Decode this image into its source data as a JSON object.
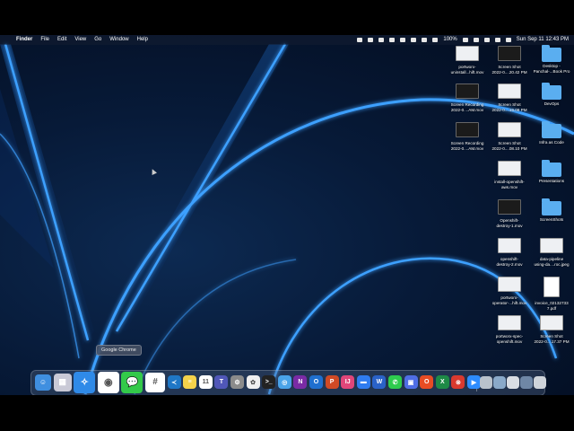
{
  "menubar": {
    "app_name": "Finder",
    "items": [
      "File",
      "Edit",
      "View",
      "Go",
      "Window",
      "Help"
    ],
    "battery": "100%",
    "datetime": "Sun Sep 11  12:43 PM"
  },
  "tooltip": "Google Chrome",
  "desktop_items": [
    {
      "label1": "portworx-",
      "label2": "uninstall...hift.mov",
      "kind": "light"
    },
    {
      "label1": "Screen Shot",
      "label2": "2022-0....20.42 PM",
      "kind": "dark"
    },
    {
      "label1": "Desktop -",
      "label2": "Panchal-...Book Pro",
      "kind": "folder"
    },
    {
      "label1": "Screen Recording",
      "label2": "2022-0....AM.mov",
      "kind": "dark"
    },
    {
      "label1": "Screen Shot",
      "label2": "2022-0....19.09 PM",
      "kind": "light"
    },
    {
      "label1": "DevOps",
      "label2": "",
      "kind": "folder"
    },
    {
      "label1": "Screen Recording",
      "label2": "2022-0....AM.mov",
      "kind": "dark"
    },
    {
      "label1": "Screen Shot",
      "label2": "2022-0....08.10 PM",
      "kind": "light"
    },
    {
      "label1": "Infra as Code",
      "label2": "",
      "kind": "folder"
    },
    {
      "label1": "install-openshift-",
      "label2": "aws.mov",
      "kind": "light"
    },
    {
      "label1": "Presentations",
      "label2": "",
      "kind": "folder"
    },
    {
      "label1": "Openshift-",
      "label2": "destroy-1.mov",
      "kind": "dark"
    },
    {
      "label1": "ScreenShots",
      "label2": "",
      "kind": "folder"
    },
    {
      "label1": "openshift-",
      "label2": "destroy-2.mov",
      "kind": "light"
    },
    {
      "label1": "data-pipeline",
      "label2": "using-da....roc.jpeg",
      "kind": "light"
    },
    {
      "label1": "portworx-",
      "label2": "operator-...hift.mov",
      "kind": "light"
    },
    {
      "label1": "invoice_02132733",
      "label2": "7.pdf",
      "kind": "doc"
    },
    {
      "label1": "portworx-spec-",
      "label2": "openshift.mov",
      "kind": "light"
    },
    {
      "label1": "Screen Shot",
      "label2": "2022-0....17.37 PM",
      "kind": "light"
    }
  ],
  "dock_apps": [
    {
      "icon": "finder-icon",
      "color": "#3f8fe0",
      "glyph": "☺"
    },
    {
      "icon": "launchpad-icon",
      "color": "#c9c9d6",
      "glyph": "▦"
    },
    {
      "icon": "safari-icon",
      "color": "#2f8ae8",
      "glyph": "✧"
    },
    {
      "icon": "chrome-icon",
      "color": "#ffffff",
      "glyph": "◉"
    },
    {
      "icon": "messages-icon",
      "color": "#33c94a",
      "glyph": "💬"
    },
    {
      "icon": "slack-icon",
      "color": "#ffffff",
      "glyph": "#"
    },
    {
      "icon": "vscode-icon",
      "color": "#1f77c6",
      "glyph": "≺"
    },
    {
      "icon": "notes-icon",
      "color": "#f5d24b",
      "glyph": "≡"
    },
    {
      "icon": "calendar-icon",
      "color": "#ffffff",
      "glyph": "11"
    },
    {
      "icon": "teams-icon",
      "color": "#5057b8",
      "glyph": "T"
    },
    {
      "icon": "settings-icon",
      "color": "#8b8b8b",
      "glyph": "⚙"
    },
    {
      "icon": "photos-icon",
      "color": "#f0f0f0",
      "glyph": "✿"
    },
    {
      "icon": "terminal-icon",
      "color": "#222222",
      "glyph": ">_"
    },
    {
      "icon": "preview-icon",
      "color": "#4aa3e8",
      "glyph": "◎"
    },
    {
      "icon": "onenote-icon",
      "color": "#7a2ba5",
      "glyph": "N"
    },
    {
      "icon": "outlook-icon",
      "color": "#1f6fcf",
      "glyph": "O"
    },
    {
      "icon": "powerpoint-icon",
      "color": "#d04a25",
      "glyph": "P"
    },
    {
      "icon": "intellij-icon",
      "color": "#e0467a",
      "glyph": "IJ"
    },
    {
      "icon": "keynote-icon",
      "color": "#2f7cf0",
      "glyph": "▬"
    },
    {
      "icon": "word-icon",
      "color": "#2a62c7",
      "glyph": "W"
    },
    {
      "icon": "whatsapp-icon",
      "color": "#2ecc4e",
      "glyph": "✆"
    },
    {
      "icon": "screen-recorder-icon",
      "color": "#4f6ee5",
      "glyph": "▣"
    },
    {
      "icon": "office-icon",
      "color": "#e74c24",
      "glyph": "O"
    },
    {
      "icon": "excel-icon",
      "color": "#1e8a47",
      "glyph": "X"
    },
    {
      "icon": "remote-icon",
      "color": "#d93a2f",
      "glyph": "⊗"
    },
    {
      "icon": "zoom-icon",
      "color": "#2d8cff",
      "glyph": "▶"
    }
  ],
  "dock_right": [
    {
      "icon": "downloads-stack-icon",
      "color": "#b9c2cc"
    },
    {
      "icon": "documents-stack-icon",
      "color": "#8aa9c9"
    },
    {
      "icon": "screenshots-stack-icon",
      "color": "#d9dde3"
    },
    {
      "icon": "window-stack-icon",
      "color": "#6f87a6"
    },
    {
      "icon": "trash-icon",
      "color": "#cfd4da"
    }
  ]
}
